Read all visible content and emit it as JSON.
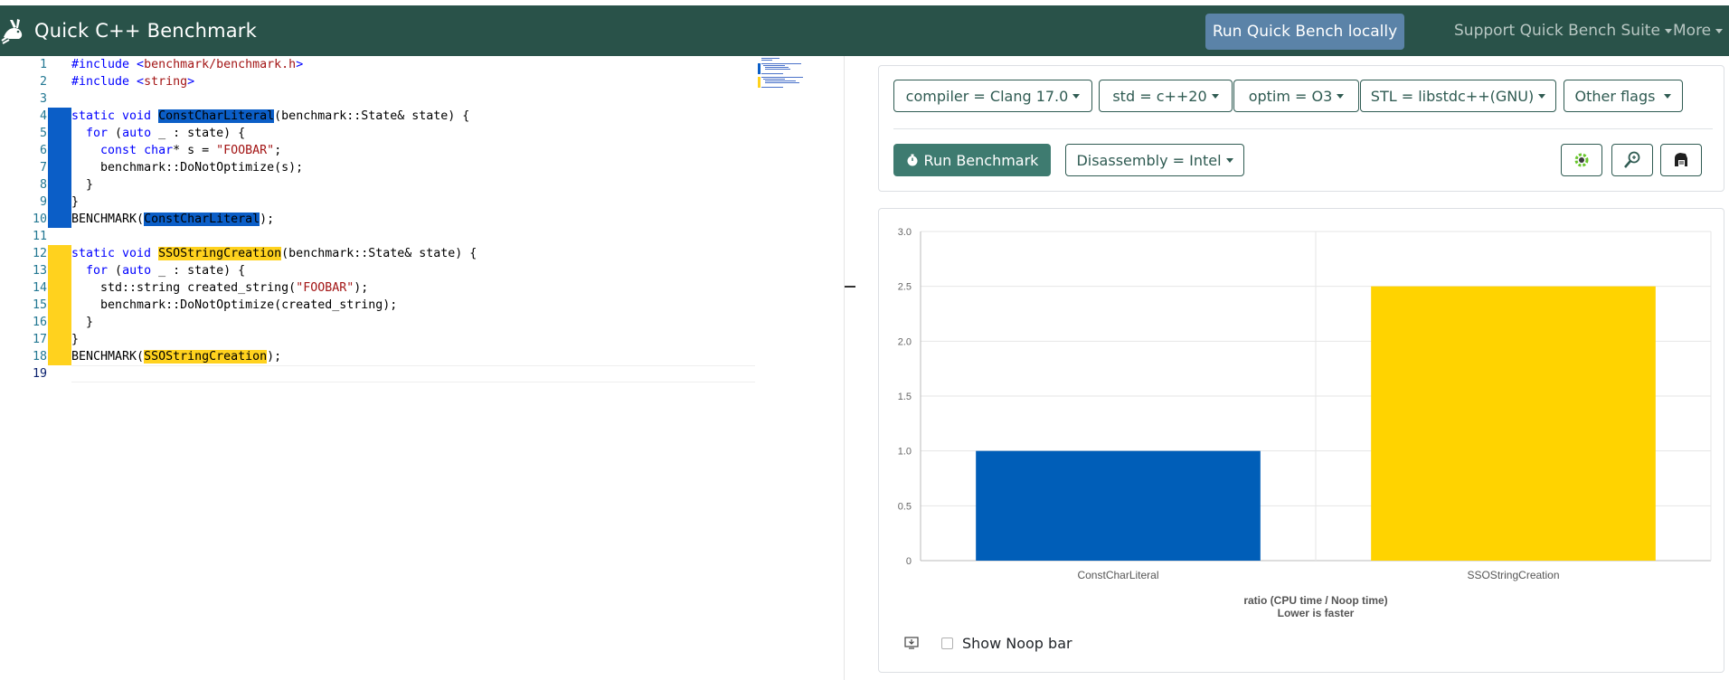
{
  "navbar": {
    "title": "Quick C++ Benchmark",
    "run_local": "Run Quick Bench locally",
    "support": "Support Quick Bench Suite",
    "more": "More"
  },
  "editor": {
    "lines": [
      {
        "n": "1"
      },
      {
        "n": "2"
      },
      {
        "n": "3"
      },
      {
        "n": "4"
      },
      {
        "n": "5"
      },
      {
        "n": "6"
      },
      {
        "n": "7"
      },
      {
        "n": "8"
      },
      {
        "n": "9"
      },
      {
        "n": "10"
      },
      {
        "n": "11"
      },
      {
        "n": "12"
      },
      {
        "n": "13"
      },
      {
        "n": "14"
      },
      {
        "n": "15"
      },
      {
        "n": "16"
      },
      {
        "n": "17"
      },
      {
        "n": "18"
      },
      {
        "n": "19"
      }
    ],
    "tokens": {
      "include": "#include",
      "lt": " <",
      "gt": ">",
      "hdr1": "benchmark/benchmark.h",
      "hdr2": "string",
      "static_void": "static void",
      "fn1": "ConstCharLiteral",
      "fn2": "SSOStringCreation",
      "sig": "(benchmark::State& state) {",
      "for_kw": "for",
      "lparen": " (",
      "auto_kw": "auto",
      "range": " _ : state) {",
      "const_kw": "const char",
      "star_s": "* s = ",
      "foobar": "\"FOOBAR\"",
      "semi": ";",
      "dno_s": "benchmark::DoNotOptimize(s);",
      "brace_close": "}",
      "bench_open": "BENCHMARK(",
      "bench_close": ");",
      "std_string": "std::string created_string(",
      "rparen_semi": ");",
      "dno_cs": "benchmark::DoNotOptimize(created_string);"
    }
  },
  "toolbar": {
    "compiler": "compiler = Clang 17.0",
    "std": "std = c++20",
    "optim": "optim = O3",
    "stl": "STL = libstdc++(GNU)",
    "other": "Other flags",
    "run": "Run Benchmark",
    "disassembly": "Disassembly = Intel"
  },
  "colors": {
    "navbar": "#295249",
    "accent": "#3e7b70",
    "bar1": "#005eb8",
    "bar2": "#ffd300"
  },
  "chart_data": {
    "type": "bar",
    "categories": [
      "ConstCharLiteral",
      "SSOStringCreation"
    ],
    "values": [
      1.0,
      2.5
    ],
    "colors": [
      "#005eb8",
      "#ffd300"
    ],
    "ylim": [
      0,
      3.0
    ],
    "yticks": [
      "0",
      "0.5",
      "1.0",
      "1.5",
      "2.0",
      "2.5",
      "3.0"
    ],
    "xlabel": "ratio (CPU time / Noop time)",
    "xlabel2": "Lower is faster",
    "grid": true
  },
  "footer": {
    "show_noop": "Show Noop bar"
  }
}
